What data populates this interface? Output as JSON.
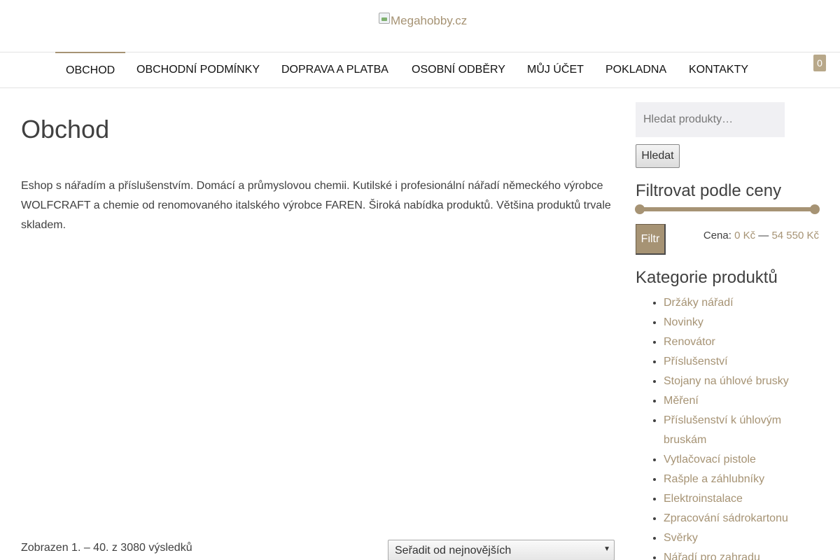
{
  "header": {
    "logo_alt": "Megahobby.cz"
  },
  "nav": {
    "items": [
      {
        "label": "OBCHOD"
      },
      {
        "label": "OBCHODNÍ PODMÍNKY"
      },
      {
        "label": "DOPRAVA A PLATBA"
      },
      {
        "label": "OSOBNÍ ODBĚRY"
      },
      {
        "label": "MŮJ ÚČET"
      },
      {
        "label": "POKLADNA"
      },
      {
        "label": "KONTAKTY"
      }
    ],
    "cart_count": "0"
  },
  "main": {
    "title": "Obchod",
    "intro": "Eshop s nářadím a příslušenstvím. Domácí a průmyslovou chemii. Kutilské i profesionální nářadí německého výrobce WOLFCRAFT a chemie od renomovaného italského výrobce FAREN. Široká nabídka produktů. Většina produktů trvale skladem.",
    "result_count": "Zobrazen 1. – 40. z 3080 výsledků",
    "sort_selected": "Seřadit od nejnovějších"
  },
  "sidebar": {
    "search_placeholder": "Hledat produkty…",
    "search_button": "Hledat",
    "price_filter_title": "Filtrovat podle ceny",
    "price_filter": {
      "range_min": 0,
      "range_max": 54550,
      "selected_min": 0,
      "selected_max": 54550
    },
    "filter_button": "Filtr",
    "price_label": "Cena:",
    "price_min": "0 Kč",
    "price_separator": "—",
    "price_max": "54 550 Kč",
    "categories_title": "Kategorie produktů",
    "categories": [
      "Držáky nářadí",
      "Novinky",
      "Renovátor",
      "Příslušenství",
      "Stojany na úhlové brusky",
      "Měření",
      "Příslušenství k úhlovým bruskám",
      "Vytlačovací pistole",
      "Rašple a záhlubníky",
      "Elektroinstalace",
      "Zpracování sádrokartonu",
      "Svěrky",
      "Nářadí pro zahradu"
    ]
  },
  "colors": {
    "accent": "#a69374",
    "text": "#404040"
  }
}
